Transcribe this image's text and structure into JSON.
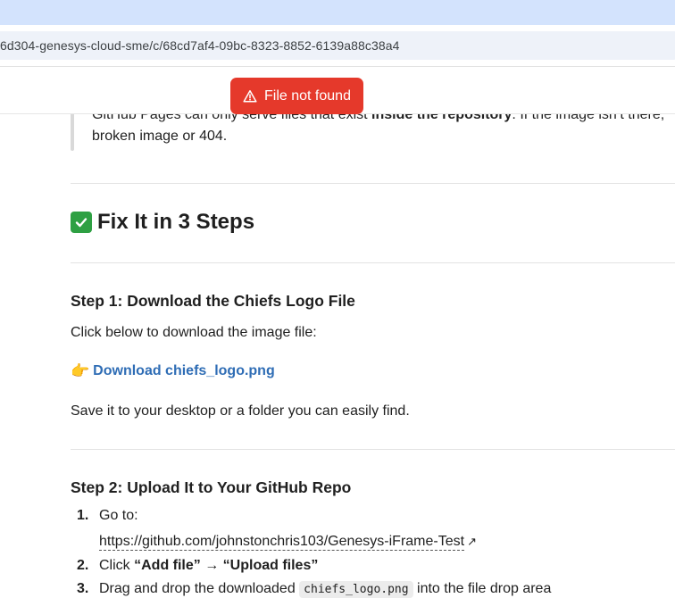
{
  "browser": {
    "url": "6d304-genesys-cloud-sme/c/68cd7af4-09bc-8323-8852-6139a88c38a4"
  },
  "toast": {
    "icon": "warning-triangle-icon",
    "text": "File not found",
    "color": "#e5392b"
  },
  "quote": {
    "line1_pre": "GitHub Pages can only serve files that exist ",
    "line1_bold": "inside the repository",
    "line1_post": ". If the image isn’t there,",
    "line2": "broken image or 404."
  },
  "fix_section": {
    "emoji": "check-mark-icon",
    "title": "Fix It in 3 Steps"
  },
  "step1": {
    "heading": "Step 1: Download the Chiefs Logo File",
    "intro": "Click below to download the image file:",
    "link_label": "Download chiefs_logo.png",
    "note": "Save it to your desktop or a folder you can easily find."
  },
  "step2": {
    "heading": "Step 2: Upload It to Your GitHub Repo",
    "items": [
      {
        "num": "1.",
        "text": "Go to:",
        "url": "https://github.com/johnstonchris103/Genesys-iFrame-Test"
      },
      {
        "num": "2.",
        "pre": "Click ",
        "b1": "“Add file”",
        "mid": " → ",
        "b2": "“Upload files”"
      },
      {
        "num": "3.",
        "pre": "Drag and drop the downloaded ",
        "code": "chiefs_logo.png",
        "post": " into the file drop area"
      }
    ]
  },
  "colors": {
    "link": "#2f6db5",
    "tabstrip": "#d3e3fd"
  }
}
